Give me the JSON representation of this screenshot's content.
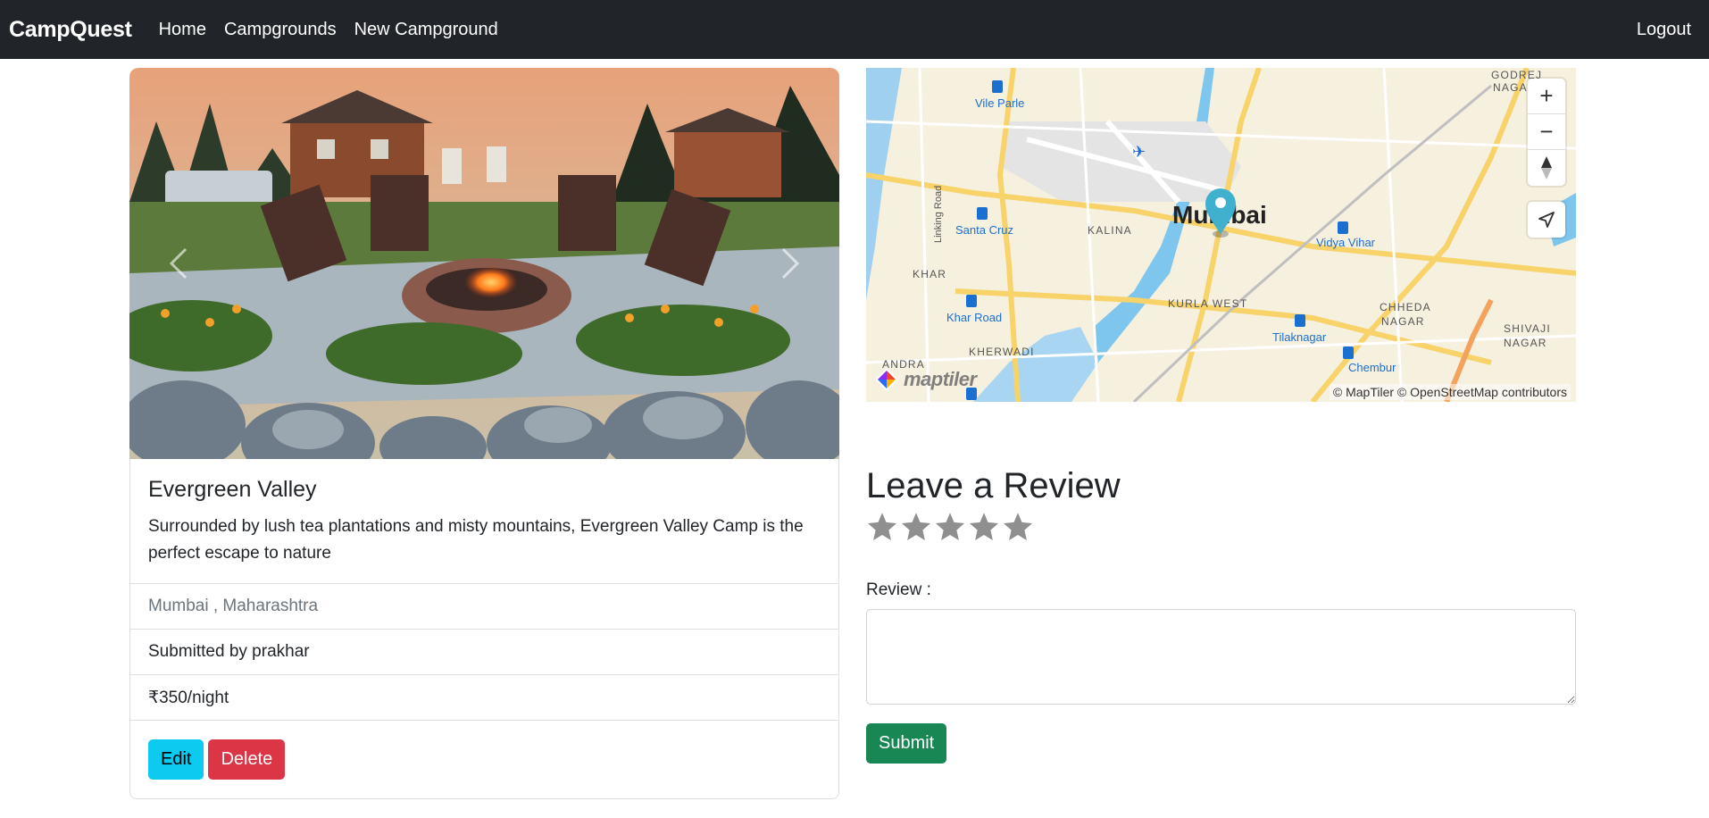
{
  "navbar": {
    "brand": "CampQuest",
    "links": [
      "Home",
      "Campgrounds",
      "New Campground"
    ],
    "logout": "Logout"
  },
  "campground": {
    "title": "Evergreen Valley",
    "description": "Surrounded by lush tea plantations and misty mountains, Evergreen Valley Camp is the perfect escape to nature",
    "location": "Mumbai , Maharashtra",
    "submitted_by": "Submitted by prakhar",
    "price": "₹350/night",
    "edit_label": "Edit",
    "delete_label": "Delete"
  },
  "map": {
    "city_label": "Mumbai",
    "places": [
      "Vile Parle",
      "Santa Cruz",
      "KALINA",
      "KHAR",
      "Khar Road",
      "Vidya Vihar",
      "KURLA WEST",
      "CHHEDA",
      "NAGAR",
      "Tilaknagar",
      "Chembur",
      "SHIVAJI",
      "NAGAR",
      "KHERWADI",
      "GODREJ",
      "NAGA",
      "Linking Road",
      "ANDRA"
    ],
    "zoom_in": "+",
    "zoom_out": "−",
    "attribution": "© MapTiler © OpenStreetMap contributors",
    "logo_text": "maptiler"
  },
  "review": {
    "heading": "Leave a Review",
    "star_count": 5,
    "rating": 0,
    "label": "Review :",
    "text_value": "",
    "submit_label": "Submit"
  },
  "colors": {
    "navbar": "#212529",
    "info": "#0dcaf0",
    "danger": "#dc3545",
    "success": "#198754",
    "star_inactive": "#8f8f8f",
    "map_marker": "#3fb1ce"
  }
}
